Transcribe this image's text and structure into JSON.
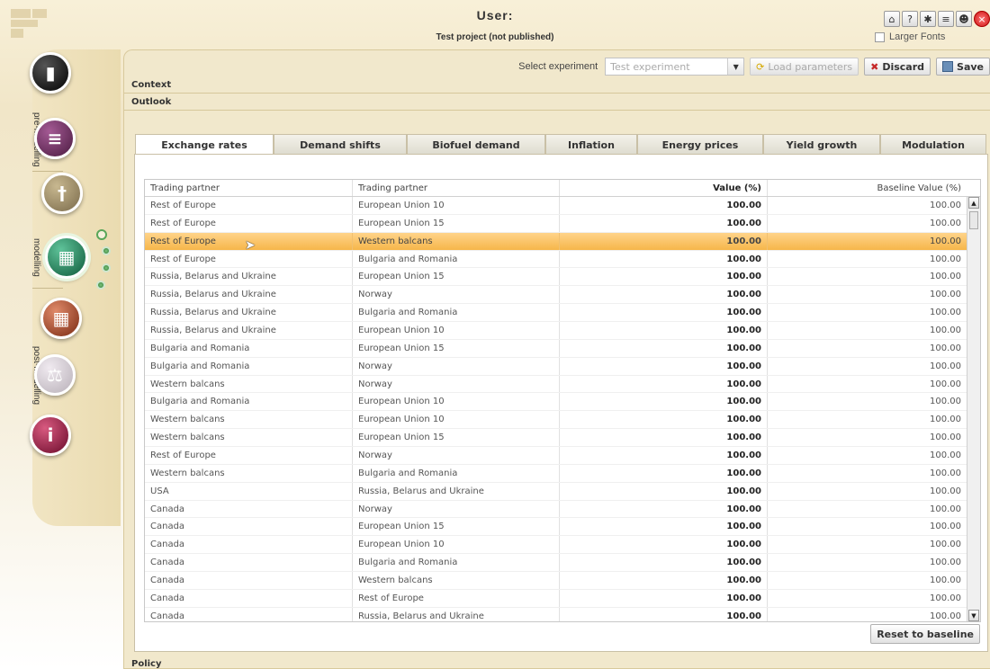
{
  "header": {
    "user_label": "User:",
    "project_label": "Test project (not published)",
    "larger_fonts_label": "Larger Fonts",
    "top_icons": [
      "home-icon",
      "help-icon",
      "settings-icon",
      "book-icon",
      "users-icon",
      "close-icon"
    ]
  },
  "sidebar": {
    "sections": [
      "pre-modelling",
      "modelling",
      "post-modelling"
    ]
  },
  "toolbar": {
    "select_label": "Select experiment",
    "experiment_value": "Test experiment",
    "load_label": "Load parameters",
    "discard_label": "Discard",
    "save_label": "Save"
  },
  "sections": {
    "context": "Context",
    "outlook": "Outlook",
    "policy": "Policy"
  },
  "tabs": [
    {
      "label": "Exchange rates"
    },
    {
      "label": "Demand shifts"
    },
    {
      "label": "Biofuel demand"
    },
    {
      "label": "Inflation"
    },
    {
      "label": "Energy prices"
    },
    {
      "label": "Yield growth"
    },
    {
      "label": "Modulation"
    }
  ],
  "grid": {
    "columns": [
      "Trading partner",
      "Trading partner",
      "Value (%)",
      "Baseline Value (%)"
    ],
    "selected_row_index": 2,
    "rows": [
      [
        "Rest of Europe",
        "European Union 10",
        "100.00",
        "100.00"
      ],
      [
        "Rest of Europe",
        "European Union 15",
        "100.00",
        "100.00"
      ],
      [
        "Rest of Europe",
        "Western balcans",
        "100.00",
        "100.00"
      ],
      [
        "Rest of Europe",
        "Bulgaria and Romania",
        "100.00",
        "100.00"
      ],
      [
        "Russia, Belarus and Ukraine",
        "European Union 15",
        "100.00",
        "100.00"
      ],
      [
        "Russia, Belarus and Ukraine",
        "Norway",
        "100.00",
        "100.00"
      ],
      [
        "Russia, Belarus and Ukraine",
        "Bulgaria and Romania",
        "100.00",
        "100.00"
      ],
      [
        "Russia, Belarus and Ukraine",
        "European Union 10",
        "100.00",
        "100.00"
      ],
      [
        "Bulgaria and Romania",
        "European Union 15",
        "100.00",
        "100.00"
      ],
      [
        "Bulgaria and Romania",
        "Norway",
        "100.00",
        "100.00"
      ],
      [
        "Western balcans",
        "Norway",
        "100.00",
        "100.00"
      ],
      [
        "Bulgaria and Romania",
        "European Union 10",
        "100.00",
        "100.00"
      ],
      [
        "Western balcans",
        "European Union 10",
        "100.00",
        "100.00"
      ],
      [
        "Western balcans",
        "European Union 15",
        "100.00",
        "100.00"
      ],
      [
        "Rest of Europe",
        "Norway",
        "100.00",
        "100.00"
      ],
      [
        "Western balcans",
        "Bulgaria and Romania",
        "100.00",
        "100.00"
      ],
      [
        "USA",
        "Russia, Belarus and Ukraine",
        "100.00",
        "100.00"
      ],
      [
        "Canada",
        "Norway",
        "100.00",
        "100.00"
      ],
      [
        "Canada",
        "European Union 15",
        "100.00",
        "100.00"
      ],
      [
        "Canada",
        "European Union 10",
        "100.00",
        "100.00"
      ],
      [
        "Canada",
        "Bulgaria and Romania",
        "100.00",
        "100.00"
      ],
      [
        "Canada",
        "Western balcans",
        "100.00",
        "100.00"
      ],
      [
        "Canada",
        "Rest of Europe",
        "100.00",
        "100.00"
      ],
      [
        "Canada",
        "Russia, Belarus and Ukraine",
        "100.00",
        "100.00"
      ]
    ]
  },
  "reset_label": "Reset to baseline",
  "colors": {
    "selected_row": "#f6b64a",
    "panel_bg": "#f1e8cc",
    "orb_colors": [
      "#222222",
      "#6b2a5b",
      "#8a7a5a",
      "#1f7a5a",
      "#9a4a2a",
      "#c9c2c8",
      "#8e1f3e"
    ]
  }
}
